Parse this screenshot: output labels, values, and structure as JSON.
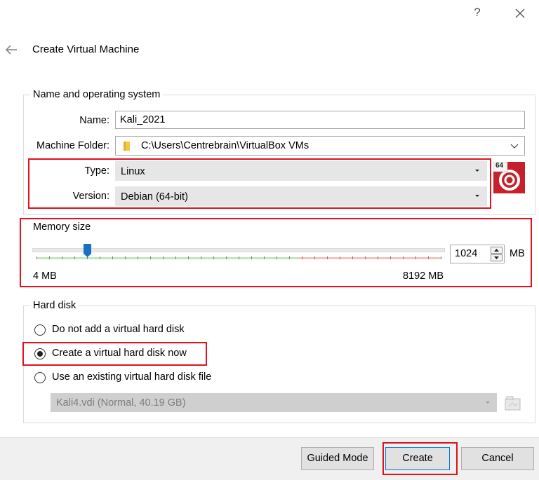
{
  "titlebar": {
    "help_label": "?",
    "close_icon": "close-icon"
  },
  "header": {
    "title": "Create Virtual Machine",
    "back_icon": "arrow-left-icon"
  },
  "name_os": {
    "group_title": "Name and operating system",
    "name_label": "Name:",
    "name_value": "Kali_2021",
    "folder_label": "Machine Folder:",
    "folder_value": "C:\\Users\\Centrebrain\\VirtualBox VMs",
    "type_label": "Type:",
    "type_value": "Linux",
    "version_label": "Version:",
    "version_value": "Debian (64-bit)",
    "os_badge": "64",
    "os_icon": "debian-icon"
  },
  "memory": {
    "group_title": "Memory size",
    "value": "1024",
    "unit": "MB",
    "min_label": "4 MB",
    "max_label": "8192 MB",
    "min_mb": 4,
    "max_mb": 8192,
    "current_mb": 1024
  },
  "hard_disk": {
    "group_title": "Hard disk",
    "options": [
      {
        "label": "Do not add a virtual hard disk",
        "checked": false
      },
      {
        "label": "Create a virtual hard disk now",
        "checked": true
      },
      {
        "label": "Use an existing virtual hard disk file",
        "checked": false
      }
    ],
    "existing_file": "Kali4.vdi (Normal, 40.19 GB)"
  },
  "buttons": {
    "guided": "Guided Mode",
    "create": "Create",
    "cancel": "Cancel"
  },
  "colors": {
    "highlight_red": "#e0121f",
    "slider_thumb": "#1670c8",
    "scale_green": "#bfe9b9",
    "scale_red": "#f5c2bf"
  }
}
